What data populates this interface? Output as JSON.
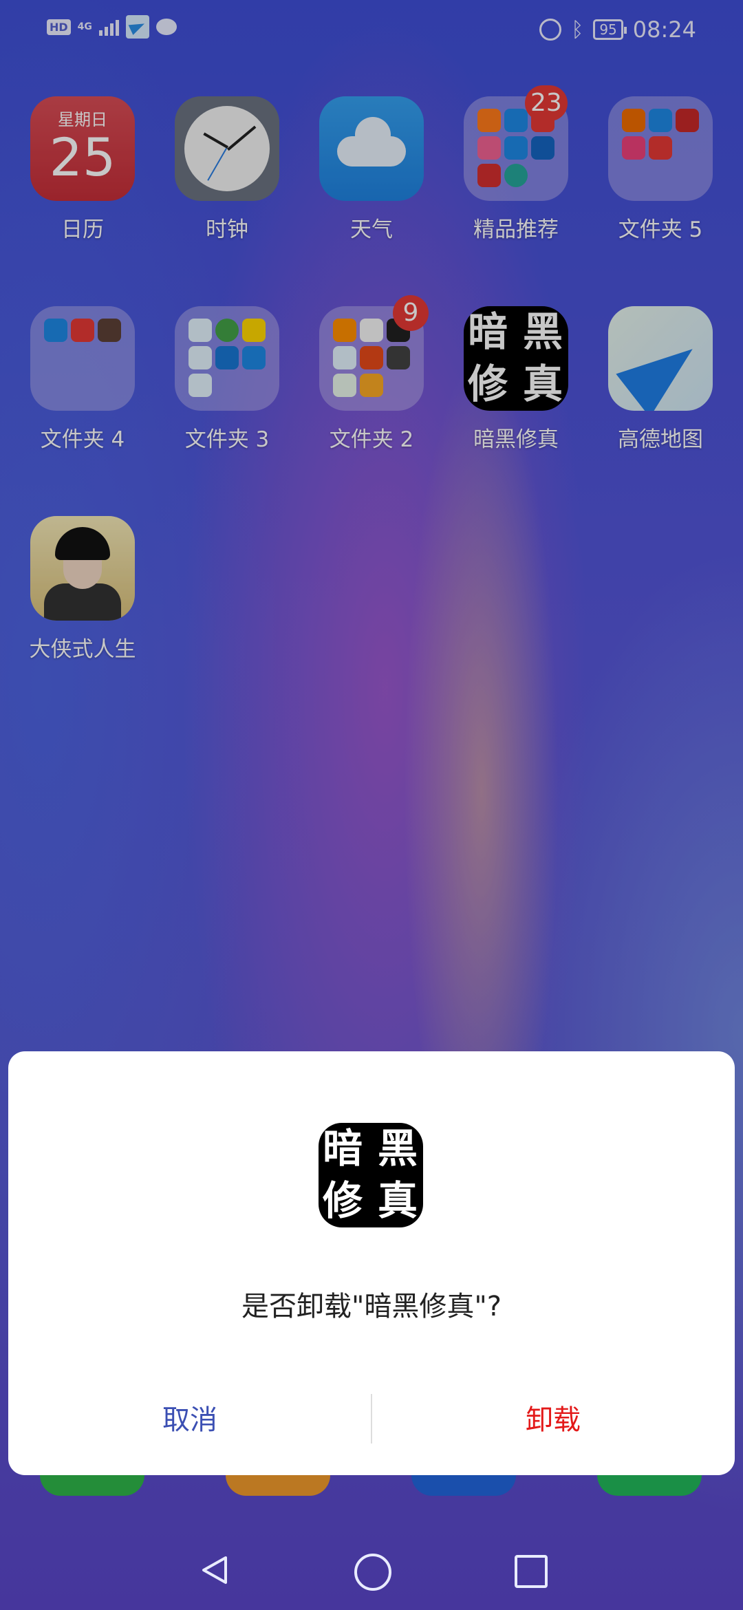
{
  "status_bar": {
    "network_badge": "HD",
    "network_type": "4G",
    "battery": "95",
    "time": "08:24"
  },
  "apps": [
    {
      "name": "calendar",
      "label": "日历",
      "weekday": "星期日",
      "day": "25"
    },
    {
      "name": "clock",
      "label": "时钟"
    },
    {
      "name": "weather",
      "label": "天气"
    },
    {
      "name": "folder-featured",
      "label": "精品推荐",
      "badge": "23"
    },
    {
      "name": "folder-5",
      "label": "文件夹 5"
    },
    {
      "name": "folder-4",
      "label": "文件夹 4"
    },
    {
      "name": "folder-3",
      "label": "文件夹 3"
    },
    {
      "name": "folder-2",
      "label": "文件夹 2",
      "badge": "9"
    },
    {
      "name": "anhei-xiuzhen",
      "label": "暗黑修真"
    },
    {
      "name": "amap",
      "label": "高德地图"
    },
    {
      "name": "daxia-rensheng",
      "label": "大侠式人生"
    }
  ],
  "game_icon_text": [
    "暗",
    "黑",
    "修",
    "真"
  ],
  "dialog": {
    "question": "是否卸载\"暗黑修真\"?",
    "cancel": "取消",
    "uninstall": "卸载"
  },
  "colors": {
    "cancel": "#3b4fb3",
    "uninstall": "#e31919"
  }
}
